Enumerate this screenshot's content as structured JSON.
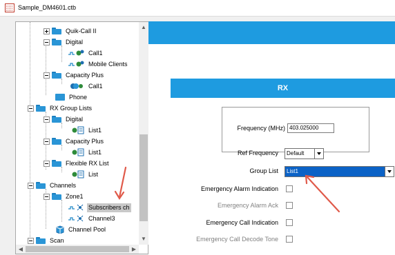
{
  "window": {
    "title": "Sample_DM4601.ctb"
  },
  "tree": {
    "items": [
      {
        "label": "Quik-Call II"
      },
      {
        "label": "Digital"
      },
      {
        "label": "Call1"
      },
      {
        "label": "Mobile Clients"
      },
      {
        "label": "Capacity Plus"
      },
      {
        "label": "Call1"
      },
      {
        "label": "Phone"
      },
      {
        "label": "RX Group Lists"
      },
      {
        "label": "Digital"
      },
      {
        "label": "List1"
      },
      {
        "label": "Capacity Plus"
      },
      {
        "label": "List1"
      },
      {
        "label": "Flexible RX List"
      },
      {
        "label": "List"
      },
      {
        "label": "Channels"
      },
      {
        "label": "Zone1"
      },
      {
        "label": "Subscribers ch"
      },
      {
        "label": "Channel3"
      },
      {
        "label": "Channel Pool"
      },
      {
        "label": "Scan"
      }
    ]
  },
  "rx": {
    "header": "RX",
    "frequency_label": "Frequency (MHz)",
    "frequency_value": "403.025000",
    "ref_frequency_label": "Ref Frequency",
    "ref_frequency_value": "Default",
    "group_list_label": "Group List",
    "group_list_value": "List1",
    "emergency_alarm_indication_label": "Emergency Alarm Indication",
    "emergency_alarm_ack_label": "Emergency Alarm Ack",
    "emergency_call_indication_label": "Emergency Call Indication",
    "emergency_call_decode_tone_label": "Emergency Call Decode Tone"
  },
  "colors": {
    "accent": "#1e9be0",
    "selection": "#0b62c6",
    "annotation_arrow": "#e05a4a"
  },
  "icons": {
    "app": "document-icon",
    "folder": "folder-icon",
    "channel": "channel-icon"
  }
}
